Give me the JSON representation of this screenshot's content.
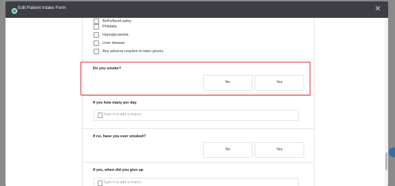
{
  "modal": {
    "title": "Edit Patient Intake Form",
    "close_icon": "close-icon"
  },
  "checkboxes": [
    {
      "label": "Bell's/facial palsy"
    },
    {
      "label": "Phlebitis"
    },
    {
      "label": "Hypoglycaemia"
    },
    {
      "label": "Liver disease"
    },
    {
      "label": "Any adverse reaction to latex gloves"
    }
  ],
  "questions": {
    "smoke": {
      "label": "Do you smoke?",
      "options": [
        "No",
        "Yes"
      ]
    },
    "per_day": {
      "label": "If yes how many per day",
      "placeholder": "Type # to add a macro"
    },
    "ever_smoked": {
      "label": "If no, have you ever smoked?",
      "options": [
        "No",
        "Yes"
      ]
    },
    "give_up": {
      "label": "If yes, when did you give up",
      "placeholder": "Type # to add a macro"
    }
  },
  "colors": {
    "header": "#3d3d45",
    "highlight": "#d62f2f",
    "logo": "#2bb39a"
  }
}
